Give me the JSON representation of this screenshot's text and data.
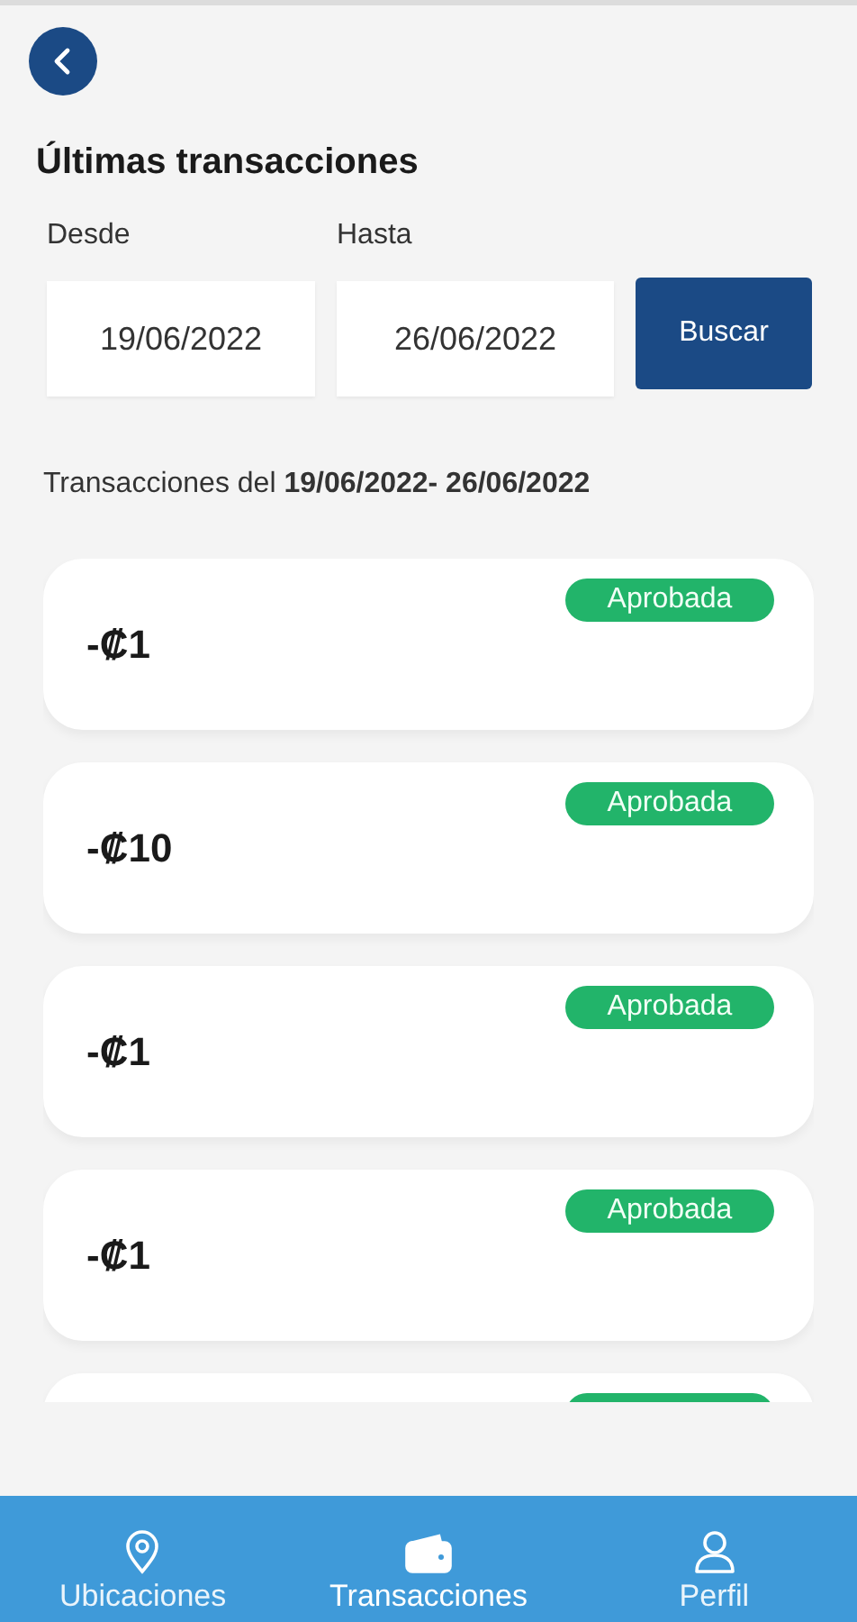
{
  "header": {
    "title": "Últimas transacciones"
  },
  "filters": [
    {
      "label": "Desde",
      "value": "19/06/2022"
    },
    {
      "label": "Hasta",
      "value": "26/06/2022"
    }
  ],
  "search_button": "Buscar",
  "summary": "Transacciones del **19/06/2022- 26/06/2022**",
  "transactions": [
    {
      "amount": "-₡1",
      "color": "#22b46a",
      "badge": "Aprobada"
    },
    {
      "amount": "-₡10",
      "color": "#22b46a",
      "badge": "Aprobada"
    },
    {
      "amount": "-₡1",
      "color": "#22b46a",
      "badge": "Aprobada"
    },
    {
      "amount": "-₡1",
      "color": "#22b46a",
      "badge": "Aprobada"
    },
    {
      "color": "#22b46a"
    }
  ],
  "nav": [
    {
      "label": "Ubicaciones",
      "selected": false
    },
    {
      "label": "Transacciones",
      "selected": true
    },
    {
      "label": "Perfil",
      "selected": false
    }
  ]
}
